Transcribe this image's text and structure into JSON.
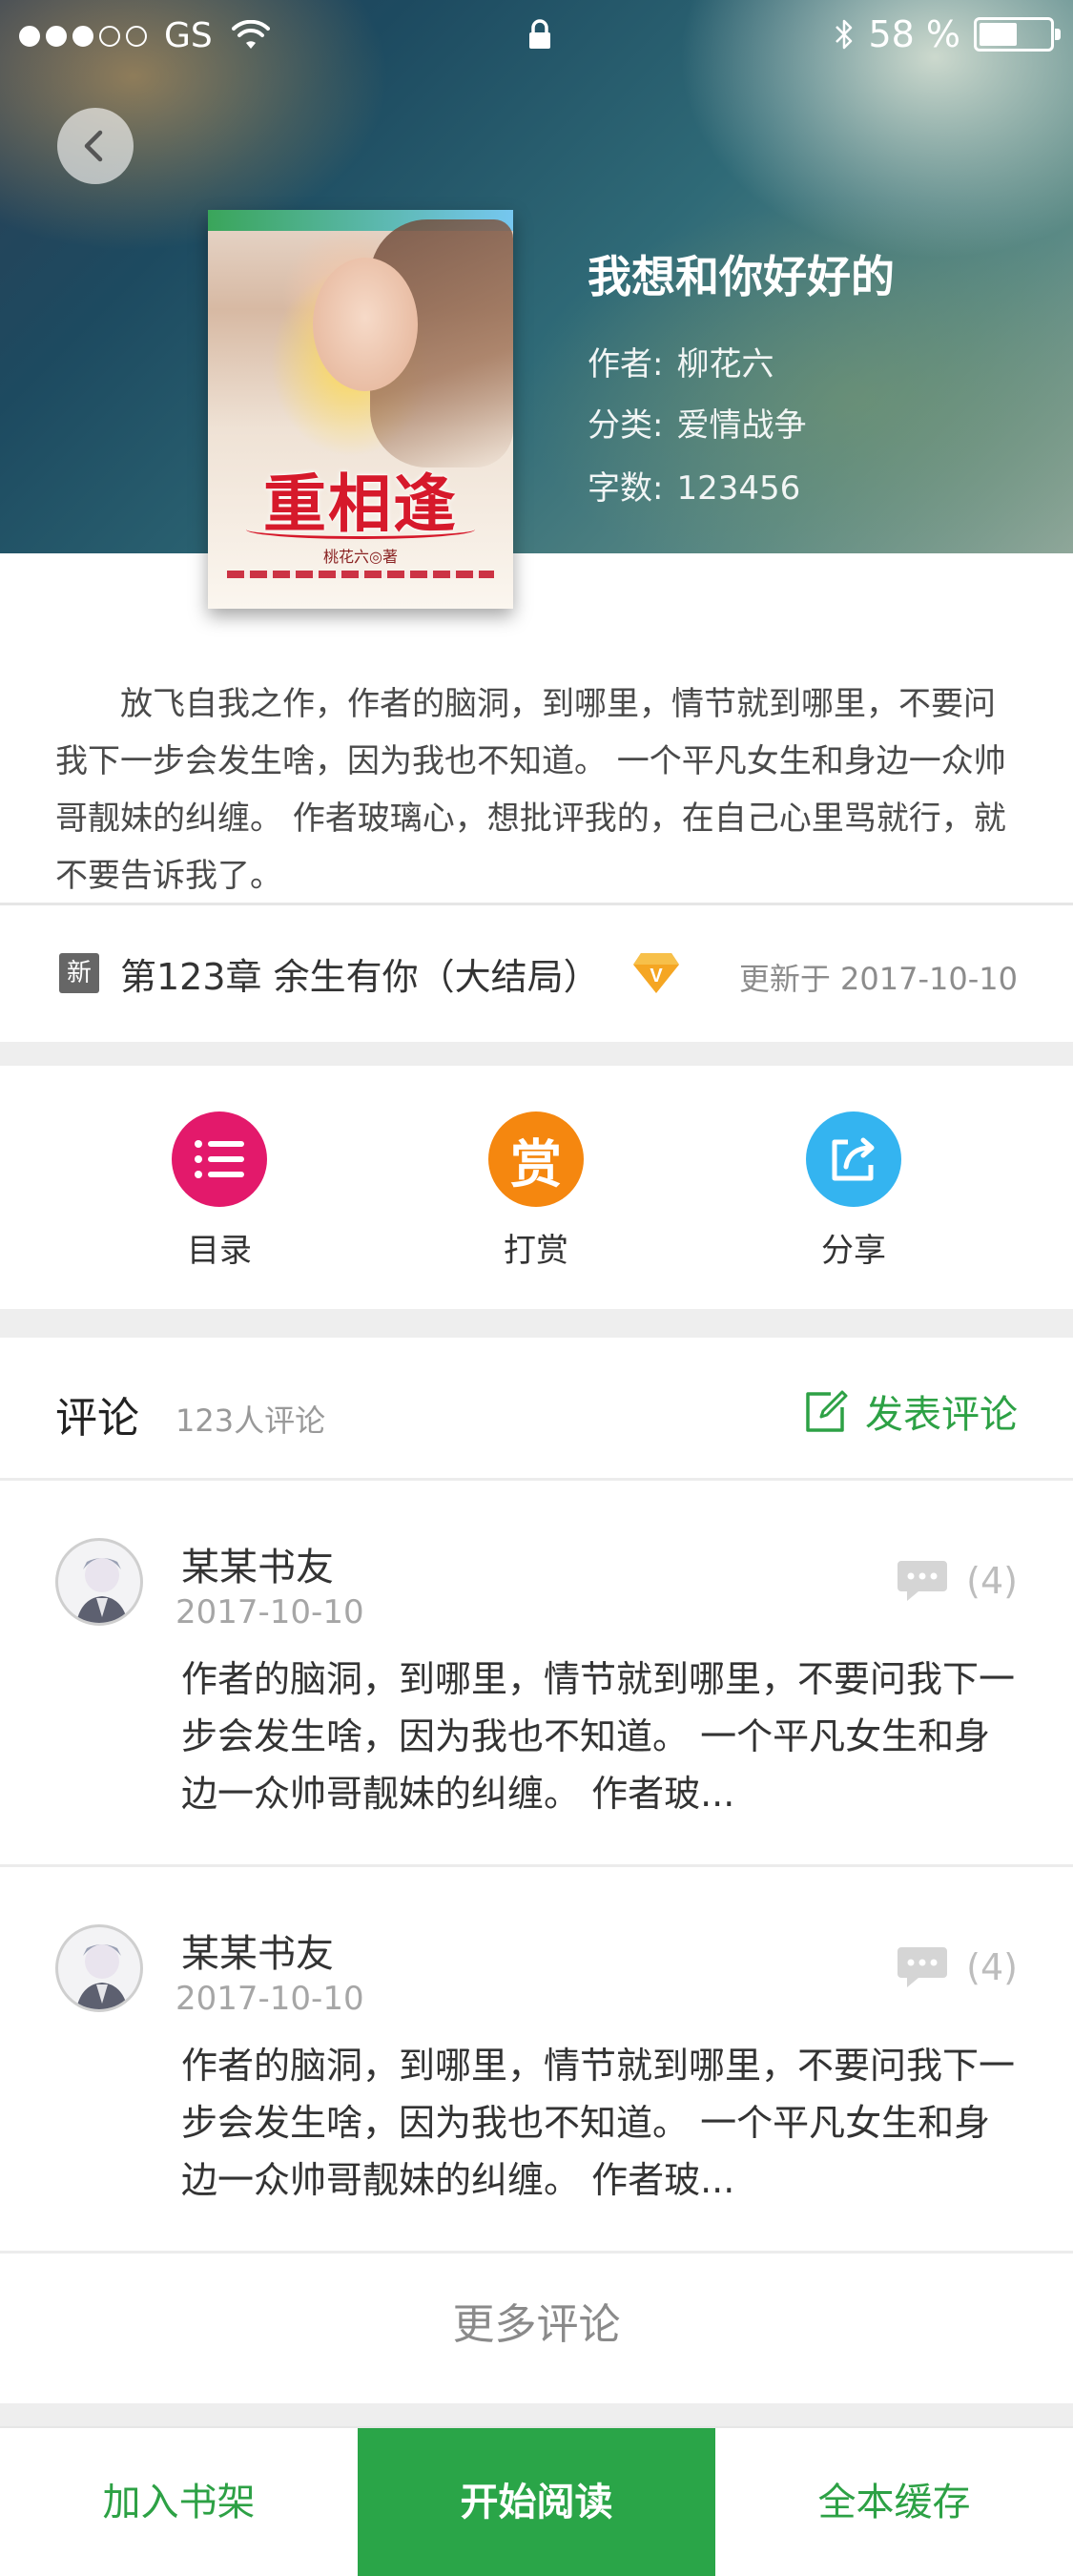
{
  "status_bar": {
    "carrier": "GS",
    "battery_percent": "58 %",
    "battery_level": 0.58
  },
  "book": {
    "title": "我想和你好好的",
    "author_label": "作者:",
    "author": "柳花六",
    "category_label": "分类:",
    "category": "爱情战争",
    "words_label": "字数:",
    "words": "123456",
    "cover": {
      "title": "重相逢",
      "author": "桃花六◎著"
    }
  },
  "intro": "放飞自我之作，作者的脑洞，到哪里，情节就到哪里，不要问我下一步会发生啥，因为我也不知道。 一个平凡女生和身边一众帅哥靓妹的纠缠。 作者玻璃心，想批评我的，在自己心里骂就行，就不要告诉我了。",
  "latest": {
    "badge": "新",
    "chapter": "第123章 余生有你（大结局）",
    "updated": "更新于 2017-10-10",
    "vip_badge": "V"
  },
  "actions": [
    {
      "label": "目录",
      "icon": "list-icon"
    },
    {
      "label": "打赏",
      "icon_text": "赏"
    },
    {
      "label": "分享",
      "icon": "share-icon"
    }
  ],
  "comments": {
    "title": "评论",
    "count": "123人评论",
    "post_label": "发表评论",
    "items": [
      {
        "user": "某某书友",
        "date": "2017-10-10",
        "replies": "(4)",
        "text": "作者的脑洞，到哪里，情节就到哪里，不要问我下一步会发生啥，因为我也不知道。 一个平凡女生和身边一众帅哥靓妹的纠缠。 作者玻..."
      },
      {
        "user": "某某书友",
        "date": "2017-10-10",
        "replies": "(4)",
        "text": "作者的脑洞，到哪里，情节就到哪里，不要问我下一步会发生啥，因为我也不知道。 一个平凡女生和身边一众帅哥靓妹的纠缠。 作者玻..."
      }
    ],
    "more_label": "更多评论"
  },
  "bottom_bar": {
    "shelf": "加入书架",
    "read": "开始阅读",
    "cache": "全本缓存"
  },
  "colors": {
    "accent_green": "#2aa548",
    "catalog_pink": "#e3196b",
    "reward_orange": "#f5870f",
    "share_blue": "#34b4f0"
  }
}
